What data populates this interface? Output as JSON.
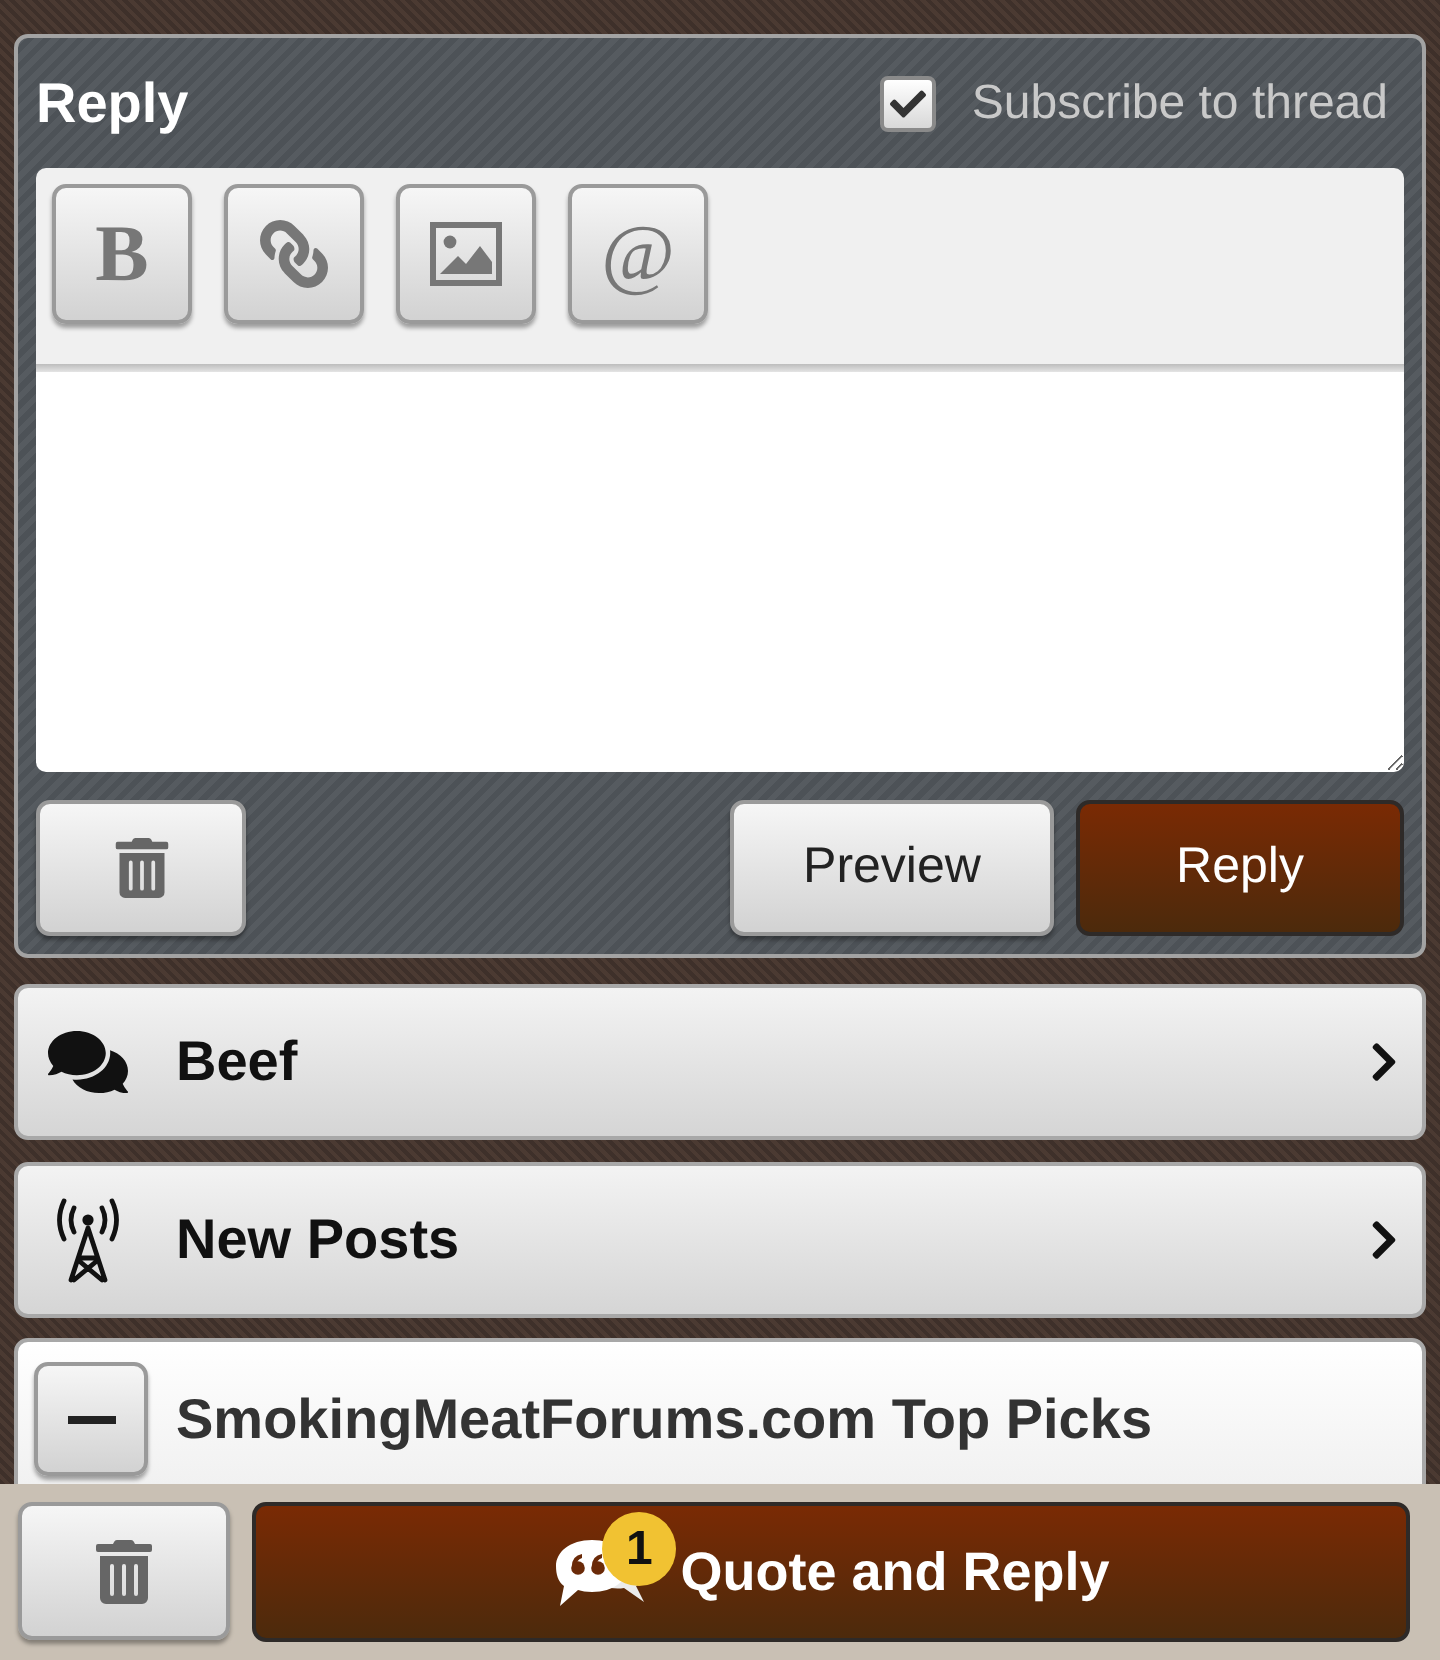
{
  "reply_form": {
    "title": "Reply",
    "subscribe": {
      "label": "Subscribe to thread",
      "checked": true
    },
    "toolbar": [
      {
        "kind": "bold",
        "label": "B"
      },
      {
        "kind": "link"
      },
      {
        "kind": "image"
      },
      {
        "kind": "mention",
        "label": "@"
      }
    ],
    "actions": [
      {
        "kind": "delete"
      },
      {
        "kind": "secondary",
        "label": "Preview"
      },
      {
        "kind": "primary",
        "label": "Reply"
      }
    ]
  },
  "nav_links": [
    {
      "kind": "chat",
      "label": "Beef"
    },
    {
      "kind": "tower",
      "label": "New Posts"
    }
  ],
  "top_picks": {
    "title": "SmokingMeatForums.com Top Picks",
    "expanded": true
  },
  "footer": {
    "actions": [
      {
        "kind": "delete"
      },
      {
        "kind": "quote",
        "label": "Quote and Reply",
        "badge": "1"
      }
    ]
  }
}
